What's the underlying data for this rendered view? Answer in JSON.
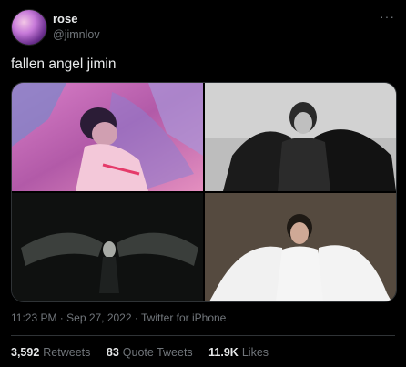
{
  "user": {
    "name": "rose",
    "handle": "@jimnlov"
  },
  "more_label": "···",
  "tweet": {
    "text": "fallen angel jimin",
    "meta": "11:23 PM · Sep 27, 2022 · Twitter for iPhone"
  },
  "stats": [
    {
      "count": "3,592",
      "label": "Retweets"
    },
    {
      "count": "83",
      "label": "Quote Tweets"
    },
    {
      "count": "11.9K",
      "label": "Likes"
    }
  ],
  "colors": {
    "background": "#000000",
    "text": "#e7e9ea",
    "muted": "#71767b",
    "border": "#2f3336"
  },
  "icons": {
    "more": "more-options-icon"
  }
}
